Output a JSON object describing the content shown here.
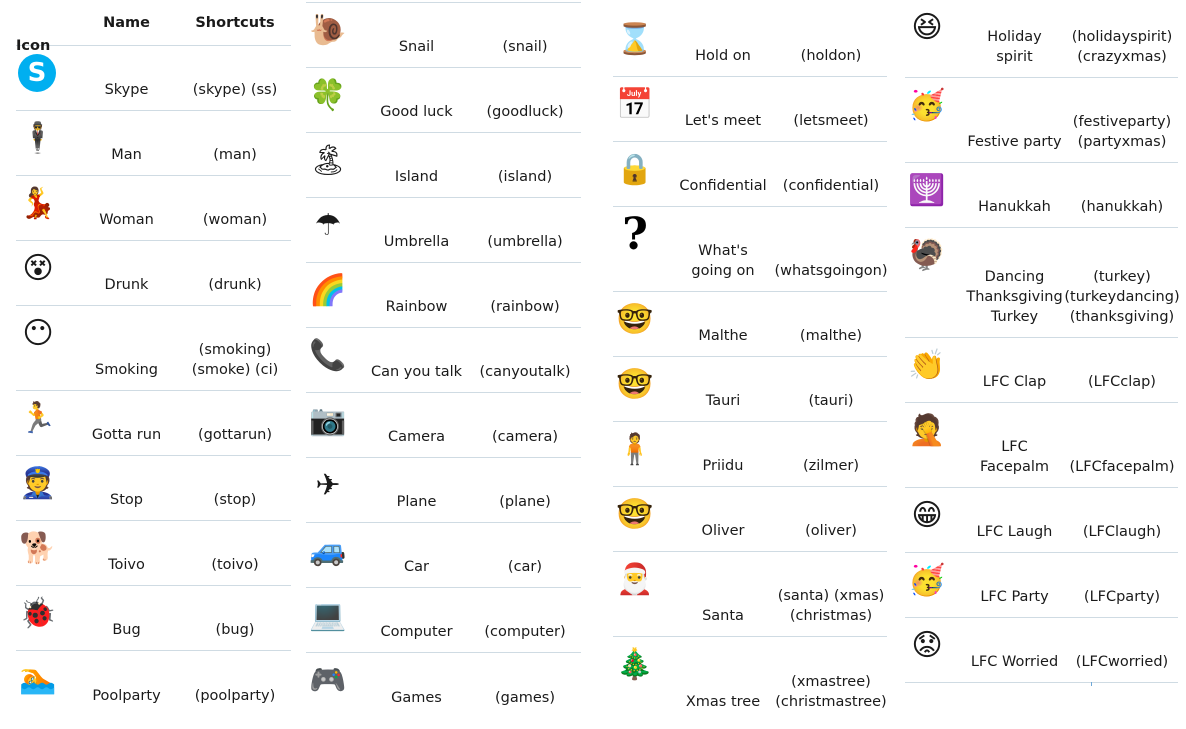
{
  "header": {
    "icon": "Icon",
    "name": "Name",
    "shortcuts": "Shortcuts"
  },
  "columns": [
    {
      "rows": [
        {
          "icon": "skype-logo-icon",
          "glyph": "S",
          "name": "Skype",
          "shortcuts": "(skype) (ss)"
        },
        {
          "icon": "man-icon",
          "glyph": "🕴",
          "name": "Man",
          "shortcuts": "(man)"
        },
        {
          "icon": "woman-icon",
          "glyph": "💃",
          "name": "Woman",
          "shortcuts": "(woman)"
        },
        {
          "icon": "drunk-emoticon-icon",
          "glyph": "😵",
          "name": "Drunk",
          "shortcuts": "(drunk)"
        },
        {
          "icon": "smoking-emoticon-icon",
          "glyph": "😶",
          "name": "Smoking",
          "shortcuts": "(smoking)\n(smoke) (ci)"
        },
        {
          "icon": "running-man-icon",
          "glyph": "🏃",
          "name": "Gotta run",
          "shortcuts": "(gottarun)"
        },
        {
          "icon": "police-officer-icon",
          "glyph": "👮",
          "name": "Stop",
          "shortcuts": "(stop)"
        },
        {
          "icon": "man-with-dog-icon",
          "glyph": "🐕",
          "name": "Toivo",
          "shortcuts": "(toivo)"
        },
        {
          "icon": "bug-icon",
          "glyph": "🐞",
          "name": "Bug",
          "shortcuts": "(bug)"
        },
        {
          "icon": "pool-party-icon",
          "glyph": "🏊",
          "name": "Poolparty",
          "shortcuts": "(poolparty)"
        }
      ]
    },
    {
      "rows": [
        {
          "icon": "snail-icon",
          "glyph": "🐌",
          "name": "Snail",
          "shortcuts": "(snail)"
        },
        {
          "icon": "four-leaf-clover-icon",
          "glyph": "🍀",
          "name": "Good luck",
          "shortcuts": "(goodluck)"
        },
        {
          "icon": "island-icon",
          "glyph": "🏝",
          "name": "Island",
          "shortcuts": "(island)"
        },
        {
          "icon": "umbrella-icon",
          "glyph": "☂",
          "name": "Umbrella",
          "shortcuts": "(umbrella)"
        },
        {
          "icon": "rainbow-icon",
          "glyph": "🌈",
          "name": "Rainbow",
          "shortcuts": "(rainbow)"
        },
        {
          "icon": "phone-icon",
          "glyph": "📞",
          "name": "Can you talk",
          "shortcuts": "(canyoutalk)"
        },
        {
          "icon": "camera-icon",
          "glyph": "📷",
          "name": "Camera",
          "shortcuts": "(camera)"
        },
        {
          "icon": "plane-icon",
          "glyph": "✈",
          "name": "Plane",
          "shortcuts": "(plane)"
        },
        {
          "icon": "car-icon",
          "glyph": "🚙",
          "name": "Car",
          "shortcuts": "(car)"
        },
        {
          "icon": "laptop-icon",
          "glyph": "💻",
          "name": "Computer",
          "shortcuts": "(computer)"
        },
        {
          "icon": "game-controller-icon",
          "glyph": "🎮",
          "name": "Games",
          "shortcuts": "(games)"
        }
      ]
    },
    {
      "rows": [
        {
          "icon": "hourglass-icon",
          "glyph": "⌛",
          "name": "Hold on",
          "shortcuts": "(holdon)"
        },
        {
          "icon": "calendar-icon",
          "glyph": "📅",
          "name": "Let's meet",
          "shortcuts": "(letsmeet)"
        },
        {
          "icon": "padlock-icon",
          "glyph": "🔒",
          "name": "Confidential",
          "shortcuts": "(confidential)"
        },
        {
          "icon": "question-mark-icon",
          "glyph": "?",
          "name": "What's\ngoing on",
          "shortcuts": "(whatsgoingon)"
        },
        {
          "icon": "malthe-emoticon-icon",
          "glyph": "🤓",
          "name": "Malthe",
          "shortcuts": "(malthe)"
        },
        {
          "icon": "tauri-emoticon-icon",
          "glyph": "🤓",
          "name": "Tauri",
          "shortcuts": "(tauri)"
        },
        {
          "icon": "priidu-person-icon",
          "glyph": "🧍",
          "name": "Priidu",
          "shortcuts": "(zilmer)"
        },
        {
          "icon": "oliver-emoticon-icon",
          "glyph": "🤓",
          "name": "Oliver",
          "shortcuts": "(oliver)"
        },
        {
          "icon": "santa-emoticon-icon",
          "glyph": "🎅",
          "name": "Santa",
          "shortcuts": "(santa) (xmas)\n(christmas)"
        },
        {
          "icon": "christmas-tree-icon",
          "glyph": "🎄",
          "name": "Xmas tree",
          "shortcuts": "(xmastree)\n(christmastree)"
        }
      ]
    },
    {
      "rows": [
        {
          "icon": "holiday-spirit-emoticon-icon",
          "glyph": "😆",
          "name": "Holiday\nspirit",
          "shortcuts": "(holidayspirit)\n(crazyxmas)"
        },
        {
          "icon": "festive-party-emoticon-icon",
          "glyph": "🥳",
          "name": "Festive party",
          "shortcuts": "(festiveparty)\n(partyxmas)"
        },
        {
          "icon": "menorah-icon",
          "glyph": "🕎",
          "name": "Hanukkah",
          "shortcuts": "(hanukkah)"
        },
        {
          "icon": "dancing-turkey-icon",
          "glyph": "🦃",
          "name": "Dancing\nThanksgiving\nTurkey",
          "shortcuts": "(turkey)\n(turkeydancing)\n(thanksgiving)"
        },
        {
          "icon": "lfc-clap-emoticon-icon",
          "glyph": "👏",
          "name": "LFC Clap",
          "shortcuts": "(LFCclap)"
        },
        {
          "icon": "lfc-facepalm-emoticon-icon",
          "glyph": "🤦",
          "name": "LFC\nFacepalm",
          "shortcuts": "(LFCfacepalm)"
        },
        {
          "icon": "lfc-laugh-emoticon-icon",
          "glyph": "😁",
          "name": "LFC Laugh",
          "shortcuts": "(LFClaugh)"
        },
        {
          "icon": "lfc-party-emoticon-icon",
          "glyph": "🥳",
          "name": "LFC Party",
          "shortcuts": "(LFCparty)"
        },
        {
          "icon": "lfc-worried-emoticon-icon",
          "glyph": "😟",
          "name": "LFC Worried",
          "shortcuts": "(LFCworried)"
        }
      ]
    }
  ],
  "colors": {
    "divider": "#cfdbe3",
    "skype_blue": "#00aff0",
    "text": "#1a1a1a"
  }
}
